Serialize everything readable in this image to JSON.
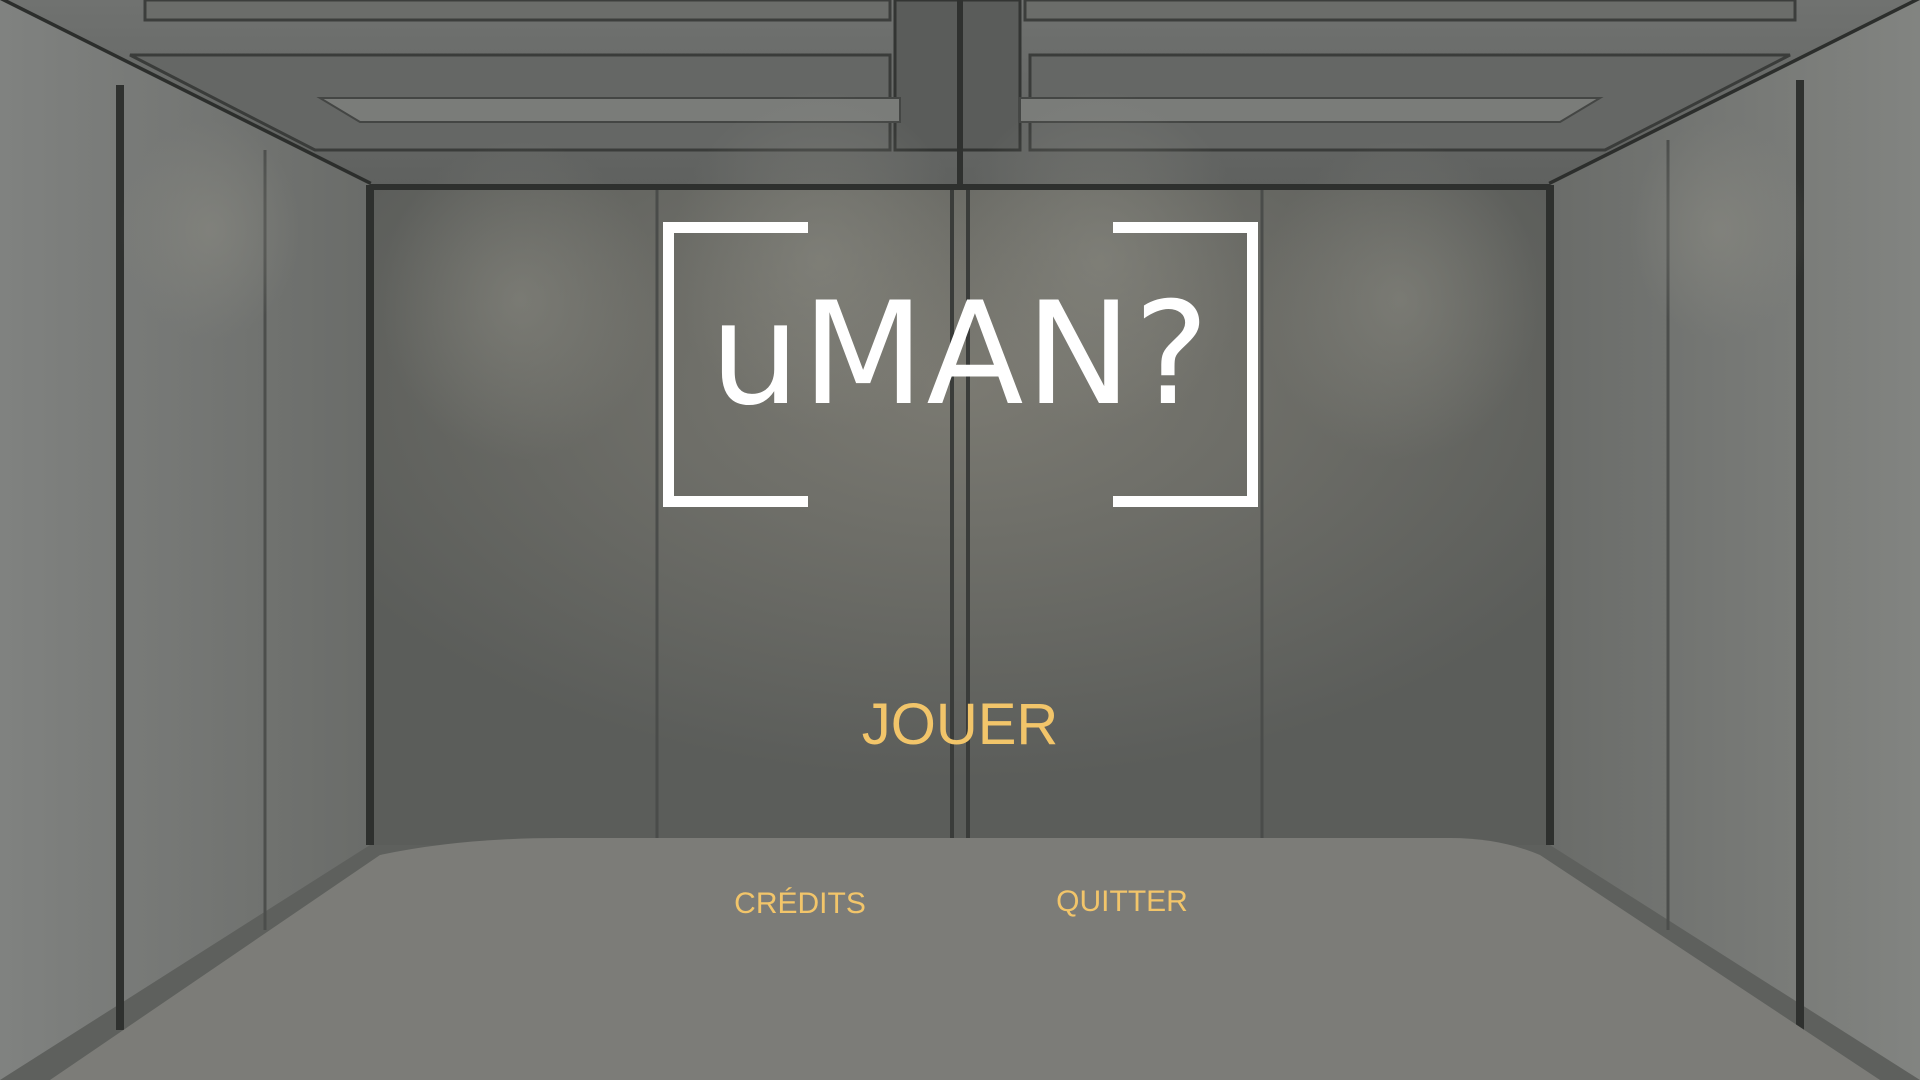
{
  "game": {
    "logo_text": "uMAN?"
  },
  "menu": {
    "play_label": "JOUER",
    "credits_label": "CRÉDITS",
    "quit_label": "QUITTER"
  },
  "colors": {
    "menu_text": "#f2c56a",
    "logo": "#ffffff",
    "wall": "#6f716d",
    "floor": "#7c7c78"
  }
}
